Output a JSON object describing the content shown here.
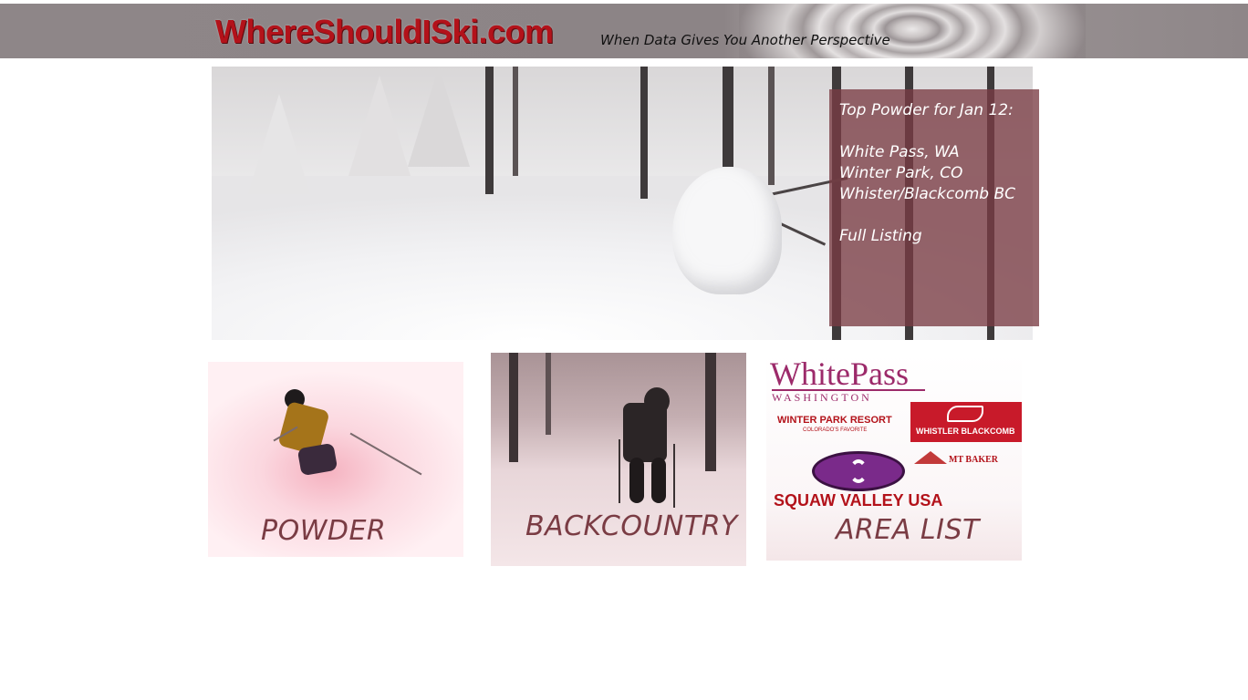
{
  "header": {
    "logo_text": "WhereShouldISki.com",
    "tagline": "When Data Gives You Another Perspective"
  },
  "hero": {
    "panel": {
      "heading": "Top Powder for Jan 12:",
      "resorts": [
        "White Pass, WA",
        "Winter Park, CO",
        "Whister/Blackcomb BC"
      ],
      "link": "Full Listing"
    }
  },
  "tiles": {
    "powder": {
      "label": "POWDER"
    },
    "backcountry": {
      "label": "BACKCOUNTRY"
    },
    "area_list": {
      "label": "AREA LIST",
      "logos": {
        "white_pass": "WhitePass",
        "white_pass_sub": "WASHINGTON",
        "winter_park": "WINTER PARK RESORT",
        "winter_park_sub": "COLORADO'S FAVORITE",
        "whistler": "WHISTLER BLACKCOMB",
        "mt_baker": "MT BAKER",
        "squaw": "SQUAW VALLEY USA"
      }
    }
  },
  "colors": {
    "accent": "#7a3c44",
    "logo_red": "#b3121a",
    "header_bg": "#8e8688"
  }
}
